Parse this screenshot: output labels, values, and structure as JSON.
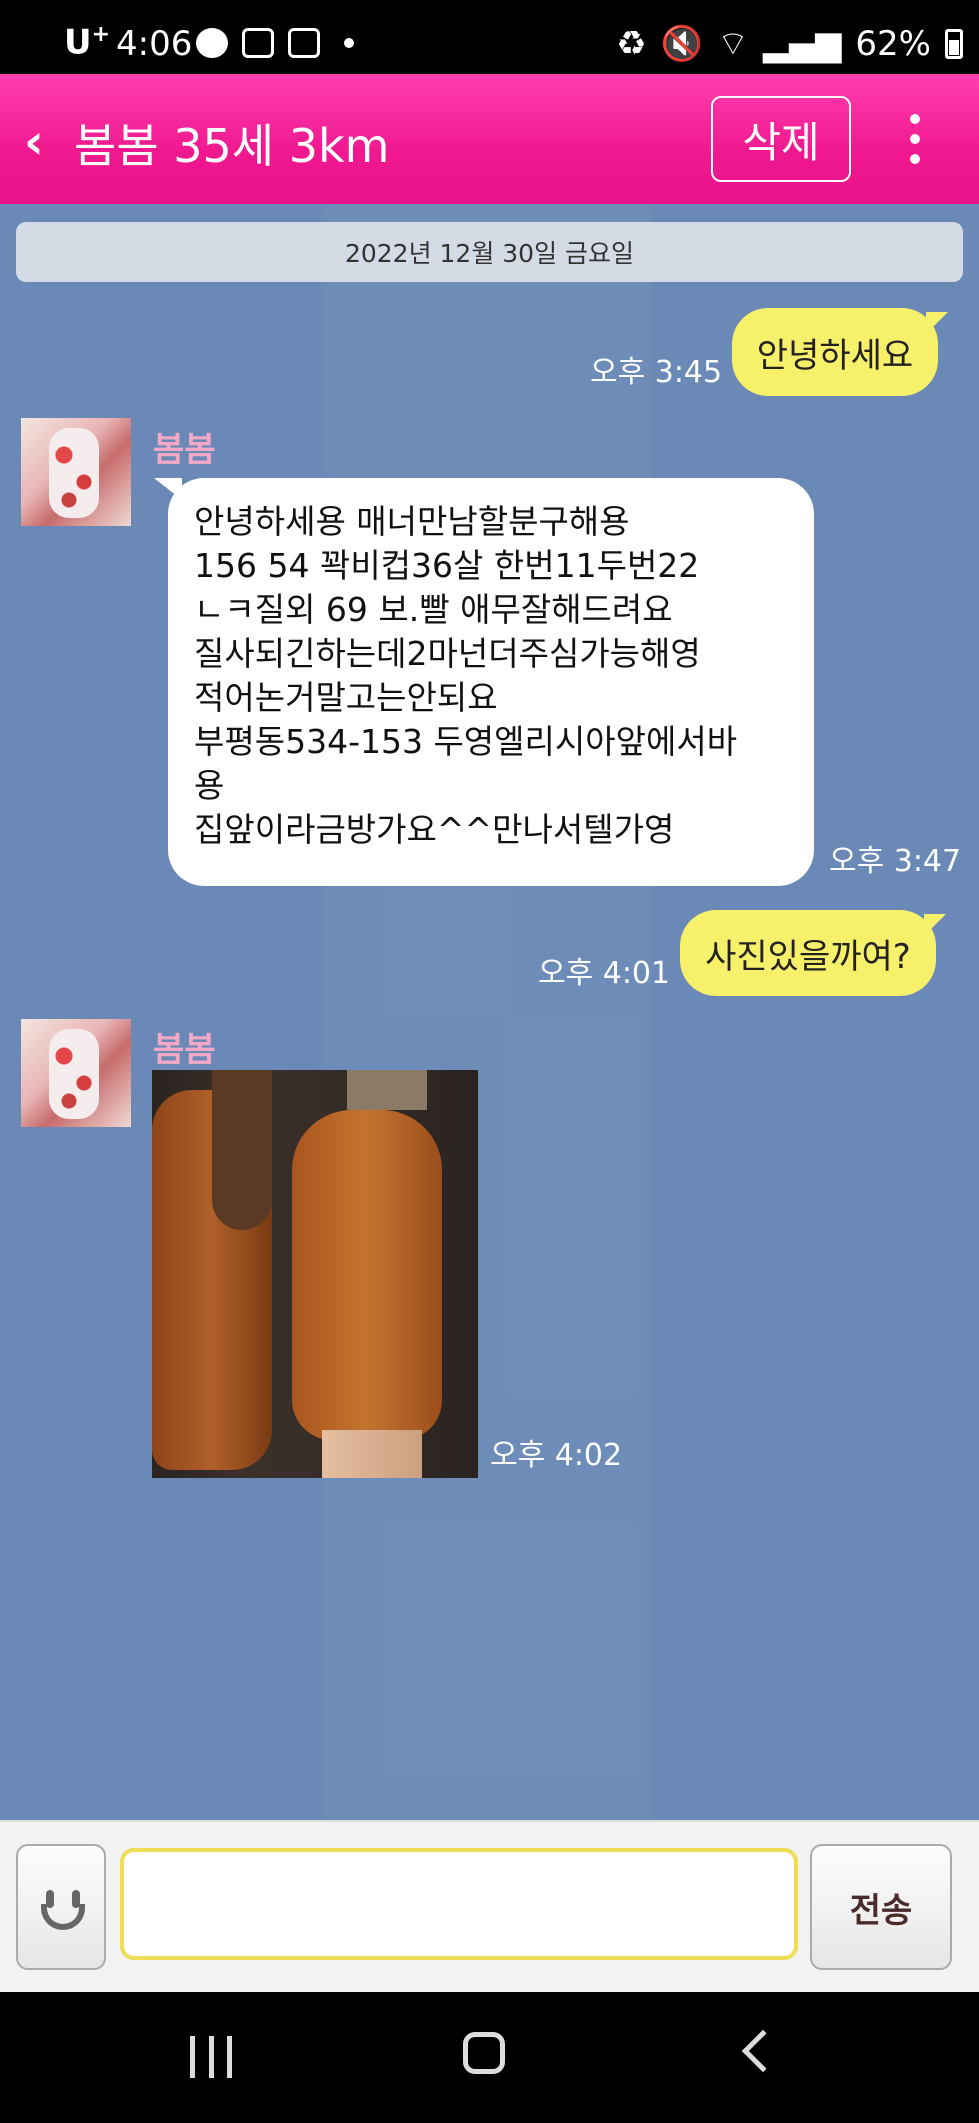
{
  "status_bar": {
    "carrier": "U",
    "carrier_sup": "+",
    "time": "4:06",
    "battery": "62%"
  },
  "header": {
    "back_icon": "chevron-left-icon",
    "title": "봄봄 35세 3km",
    "delete_label": "삭제",
    "more_icon": "more-vertical-icon",
    "background_color": "#f0188f"
  },
  "chat": {
    "date_divider": "2022년 12월 30일 금요일",
    "messages": [
      {
        "from": "me",
        "text": "안녕하세요",
        "time": "오후 3:45"
      },
      {
        "from": "them",
        "sender": "봄봄",
        "text": "안녕하세용 매너만남할분구해용\n156 54 꽉비컵36살 한번11두번22\nㄴㅋ질외 69 보.빨 애무잘해드려요\n질사되긴하는데2마넌더주심가능해영\n적어논거말고는안되요\n부평동534-153 두영엘리시아앞에서바\n용\n집앞이라금방가요^^만나서텔가영",
        "time": "오후 3:47"
      },
      {
        "from": "me",
        "text": "사진있을까여?",
        "time": "오후 4:01"
      },
      {
        "from": "them",
        "sender": "봄봄",
        "type": "photo",
        "time": "오후 4:02"
      }
    ]
  },
  "input_bar": {
    "emoji_icon": "smiley-icon",
    "placeholder": "",
    "send_label": "전송"
  },
  "nav_bar": {
    "recents_icon": "recents-icon",
    "home_icon": "home-icon",
    "back_icon": "back-icon"
  },
  "colors": {
    "my_bubble": "#f7f06a",
    "their_bubble": "#ffffff",
    "chat_bg": "#6a89b6",
    "sender_name": "#f4a8c8"
  }
}
